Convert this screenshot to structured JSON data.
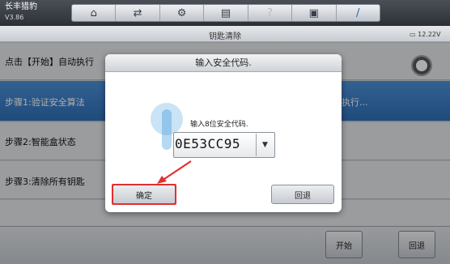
{
  "header": {
    "app_name": "长丰猎豹",
    "app_version": "V3.86",
    "toolbar": [
      {
        "icon": "home-icon",
        "glyph": "⌂"
      },
      {
        "icon": "car-tools-icon",
        "glyph": "⇄"
      },
      {
        "icon": "gear-icon",
        "glyph": "⚙"
      },
      {
        "icon": "printer-icon",
        "glyph": "▤"
      },
      {
        "icon": "help-icon",
        "glyph": "?"
      },
      {
        "icon": "save-icon",
        "glyph": "▣"
      },
      {
        "icon": "pen-icon",
        "glyph": "/"
      }
    ]
  },
  "subheader": {
    "title": "钥匙清除",
    "battery": "12.22V"
  },
  "rows": [
    {
      "label": "点击【开始】自动执行"
    },
    {
      "label": "步骤1:验证安全算法",
      "right_text": "执行..."
    },
    {
      "label": "步骤2:智能盒状态"
    },
    {
      "label": "步骤3:清除所有钥匙"
    }
  ],
  "bottom_buttons": {
    "start": "开始",
    "back": "回退"
  },
  "dialog": {
    "title": "输入安全代码.",
    "prompt": "输入8位安全代码.",
    "code_value": "0E53CC95",
    "confirm": "确定",
    "back": "回退"
  },
  "colors": {
    "selected_row": "#2f6fb8",
    "highlight_box": "#e03030",
    "pointer_arrow": "#e03030"
  }
}
